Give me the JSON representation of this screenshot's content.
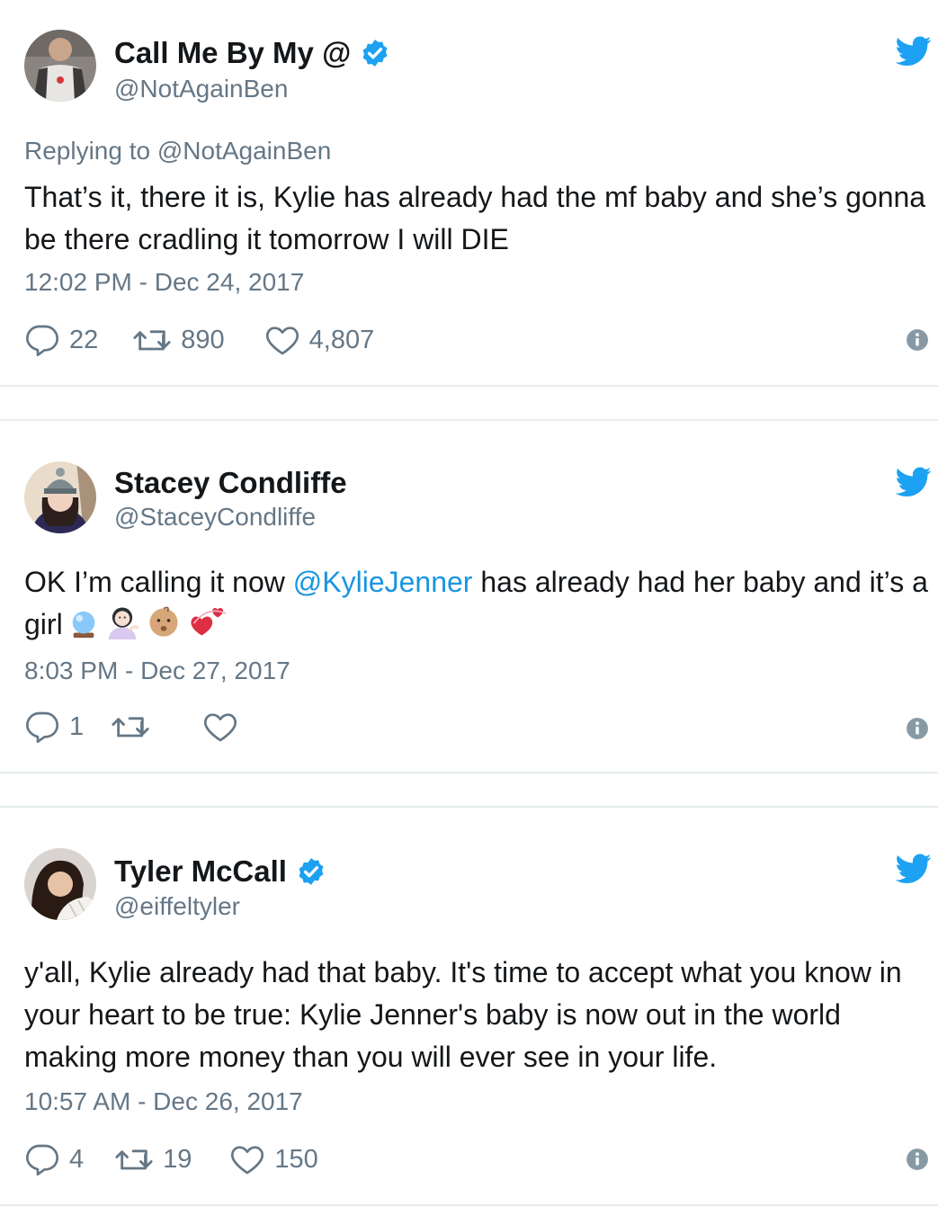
{
  "tweets": [
    {
      "name": "Call Me By My @",
      "handle": "@NotAgainBen",
      "verified": true,
      "replying_to": "Replying to @NotAgainBen",
      "text": "That’s it, there it is, Kylie has already had the mf baby and she’s gonna be there cradling it tomorrow I will DIE",
      "timestamp": "12:02 PM - Dec 24, 2017",
      "replies": "22",
      "retweets": "890",
      "likes": "4,807"
    },
    {
      "name": "Stacey Condliffe",
      "handle": "@StaceyCondliffe",
      "verified": false,
      "text_before": "OK I’m calling it now ",
      "mention": "@KylieJenner",
      "text_after": " has already had her baby and it’s a girl",
      "emojis": [
        "crystal-ball-emoji",
        "woman-tipping-hand-emoji",
        "baby-emoji",
        "revolving-hearts-emoji"
      ],
      "timestamp": "8:03 PM - Dec 27, 2017",
      "replies": "1",
      "retweets": "",
      "likes": ""
    },
    {
      "name": "Tyler McCall",
      "handle": "@eiffeltyler",
      "verified": true,
      "text": "y'all, Kylie already had that baby. It's time to accept what you know in your heart to be true: Kylie Jenner's baby is now out in the world making more money than you will ever see in your life.",
      "timestamp": "10:57 AM - Dec 26, 2017",
      "replies": "4",
      "retweets": "19",
      "likes": "150"
    }
  ],
  "colors": {
    "brand": "#1da1f2",
    "mention": "#1b95e0",
    "secondary_text": "#657786",
    "divider": "#e6ecf0"
  },
  "icons": [
    "twitter-bird-icon",
    "verified-badge-icon",
    "reply-icon",
    "retweet-icon",
    "like-icon",
    "info-icon"
  ]
}
